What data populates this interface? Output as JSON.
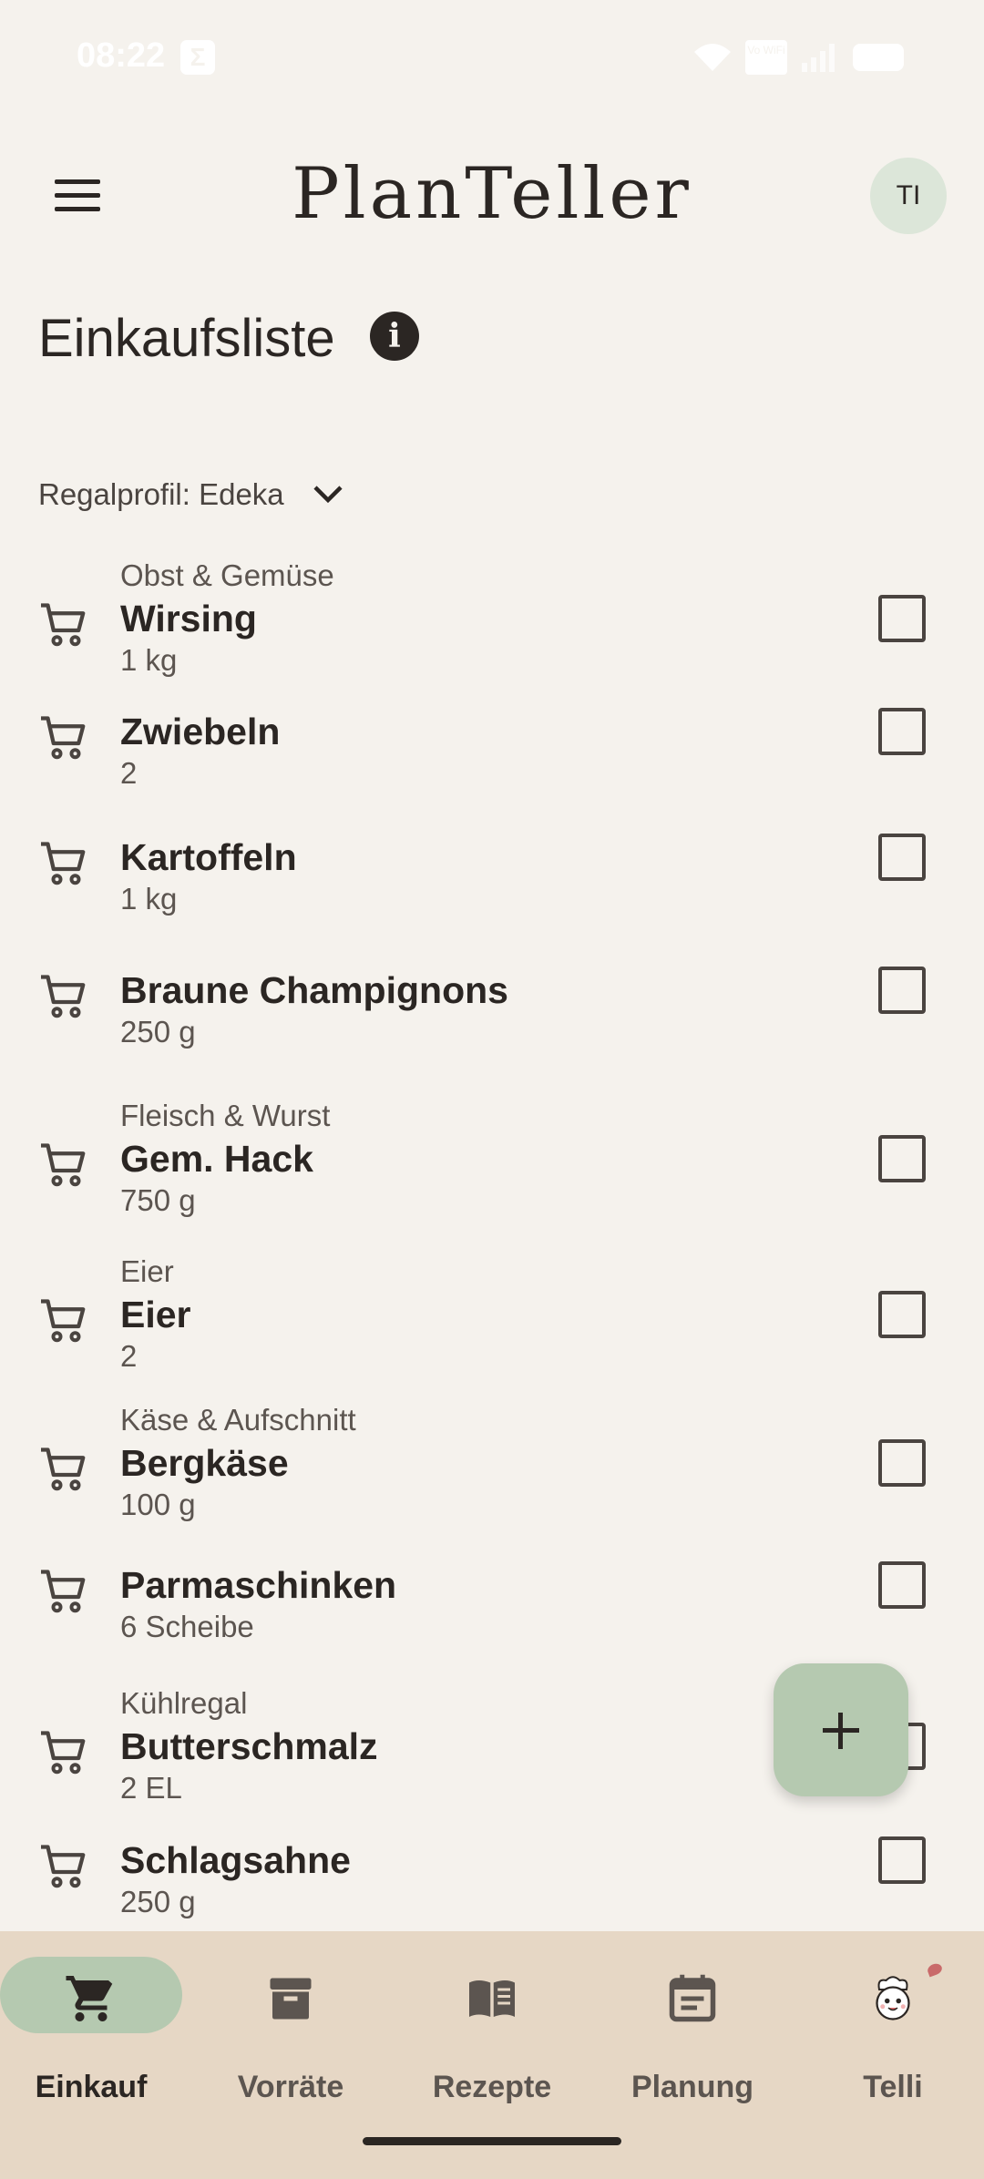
{
  "status_bar": {
    "time": "08:22",
    "app_icon_glyph": "Σ",
    "volte": "Vo WiFi"
  },
  "header": {
    "logo": "PlanTeller",
    "avatar_initials": "TI"
  },
  "page": {
    "title": "Einkaufsliste"
  },
  "profile": {
    "label": "Regalprofil: Edeka"
  },
  "items": [
    {
      "category": "Obst & Gemüse",
      "name": "Wirsing",
      "qty": "1 kg",
      "checked": false
    },
    {
      "category": "",
      "name": "Zwiebeln",
      "qty": "2",
      "checked": false
    },
    {
      "category": "",
      "name": "Kartoffeln",
      "qty": "1 kg",
      "checked": false
    },
    {
      "category": "",
      "name": "Braune Champignons",
      "qty": "250 g",
      "checked": false
    },
    {
      "category": "Fleisch & Wurst",
      "name": "Gem. Hack",
      "qty": "750 g",
      "checked": false
    },
    {
      "category": "Eier",
      "name": "Eier",
      "qty": "2",
      "checked": false
    },
    {
      "category": "Käse & Aufschnitt",
      "name": "Bergkäse",
      "qty": "100 g",
      "checked": false
    },
    {
      "category": "",
      "name": "Parmaschinken",
      "qty": "6 Scheibe",
      "checked": false
    },
    {
      "category": "Kühlregal",
      "name": "Butterschmalz",
      "qty": "2 EL",
      "checked": false
    },
    {
      "category": "",
      "name": "Schlagsahne",
      "qty": "250 g",
      "checked": false
    }
  ],
  "nav": [
    {
      "label": "Einkauf",
      "icon": "cart-icon",
      "active": true
    },
    {
      "label": "Vorräte",
      "icon": "archive-box-icon",
      "active": false
    },
    {
      "label": "Rezepte",
      "icon": "open-book-icon",
      "active": false
    },
    {
      "label": "Planung",
      "icon": "calendar-icon",
      "active": false
    },
    {
      "label": "Telli",
      "icon": "chef-mascot-icon",
      "active": false
    }
  ],
  "colors": {
    "background": "#f5f2ed",
    "accent": "#b5c9b0",
    "nav_bg": "#e6d7c5",
    "text": "#2b2623"
  }
}
